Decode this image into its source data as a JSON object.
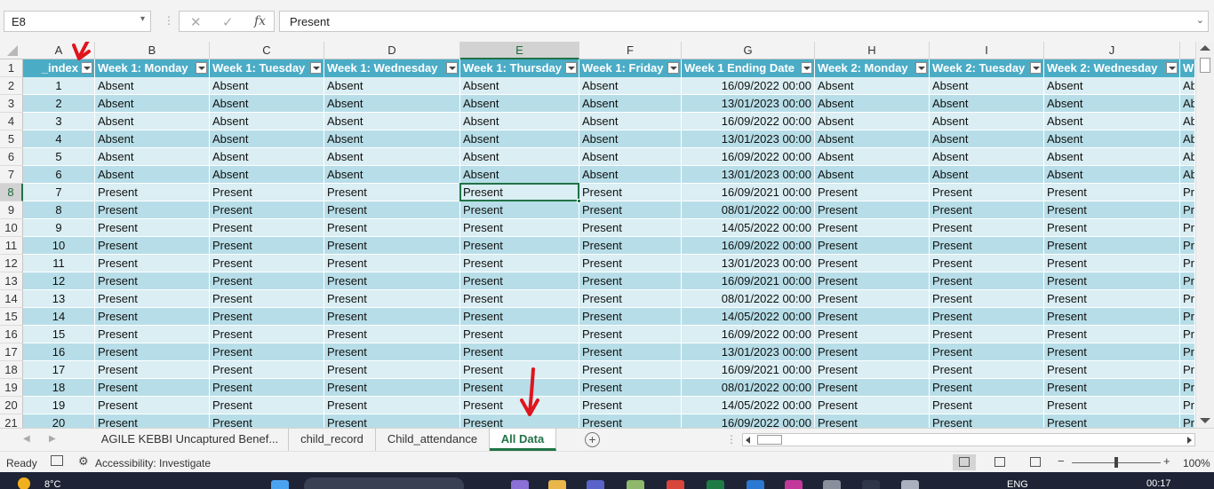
{
  "formula_bar": {
    "name_box": "E8",
    "dots": "⋮",
    "cancel_icon": "✕",
    "enter_icon": "✓",
    "fx_label": "fx",
    "value": "Present"
  },
  "columns": [
    "A",
    "B",
    "C",
    "D",
    "E",
    "F",
    "G",
    "H",
    "I",
    "J"
  ],
  "selected_column": "E",
  "table_headers": [
    "_index",
    "Week 1: Monday",
    "Week 1: Tuesday",
    "Week 1: Wednesday",
    "Week 1: Thursday",
    "Week 1: Friday",
    "Week 1 Ending Date",
    "Week 2: Monday",
    "Week 2: Tuesday",
    "Week 2: Wednesday",
    "W"
  ],
  "row_numbers": [
    1,
    2,
    3,
    4,
    5,
    6,
    7,
    8,
    9,
    10,
    11,
    12,
    13,
    14,
    15,
    16,
    17,
    18,
    19,
    20,
    21
  ],
  "selected_row": 8,
  "data_rows": [
    {
      "index": "1",
      "status": "Absent",
      "date": "16/09/2022 00:00",
      "overflow": "Ab"
    },
    {
      "index": "2",
      "status": "Absent",
      "date": "13/01/2023 00:00",
      "overflow": "Ab"
    },
    {
      "index": "3",
      "status": "Absent",
      "date": "16/09/2022 00:00",
      "overflow": "Ab"
    },
    {
      "index": "4",
      "status": "Absent",
      "date": "13/01/2023 00:00",
      "overflow": "Ab"
    },
    {
      "index": "5",
      "status": "Absent",
      "date": "16/09/2022 00:00",
      "overflow": "Ab"
    },
    {
      "index": "6",
      "status": "Absent",
      "date": "13/01/2023 00:00",
      "overflow": "Ab"
    },
    {
      "index": "7",
      "status": "Present",
      "date": "16/09/2021 00:00",
      "overflow": "Pr"
    },
    {
      "index": "8",
      "status": "Present",
      "date": "08/01/2022 00:00",
      "overflow": "Pr"
    },
    {
      "index": "9",
      "status": "Present",
      "date": "14/05/2022 00:00",
      "overflow": "Pr"
    },
    {
      "index": "10",
      "status": "Present",
      "date": "16/09/2022 00:00",
      "overflow": "Pr"
    },
    {
      "index": "11",
      "status": "Present",
      "date": "13/01/2023 00:00",
      "overflow": "Pr"
    },
    {
      "index": "12",
      "status": "Present",
      "date": "16/09/2021 00:00",
      "overflow": "Pr"
    },
    {
      "index": "13",
      "status": "Present",
      "date": "08/01/2022 00:00",
      "overflow": "Pr"
    },
    {
      "index": "14",
      "status": "Present",
      "date": "14/05/2022 00:00",
      "overflow": "Pr"
    },
    {
      "index": "15",
      "status": "Present",
      "date": "16/09/2022 00:00",
      "overflow": "Pr"
    },
    {
      "index": "16",
      "status": "Present",
      "date": "13/01/2023 00:00",
      "overflow": "Pr"
    },
    {
      "index": "17",
      "status": "Present",
      "date": "16/09/2021 00:00",
      "overflow": "Pr"
    },
    {
      "index": "18",
      "status": "Present",
      "date": "08/01/2022 00:00",
      "overflow": "Pr"
    },
    {
      "index": "19",
      "status": "Present",
      "date": "14/05/2022 00:00",
      "overflow": "Pr"
    },
    {
      "index": "20",
      "status": "Present",
      "date": "16/09/2022 00:00",
      "overflow": "Pr"
    }
  ],
  "sheet_tabs": [
    {
      "label": "AGILE KEBBI Uncaptured Benef...",
      "active": false
    },
    {
      "label": "child_record",
      "active": false
    },
    {
      "label": "Child_attendance",
      "active": false
    },
    {
      "label": "All Data",
      "active": true
    }
  ],
  "tabs_bar": {
    "add_label": "+",
    "prev_icon": "◀",
    "next_icon": "▶",
    "dots": "⋮"
  },
  "status_bar": {
    "ready": "Ready",
    "accessibility": "Accessibility: Investigate",
    "zoom_minus": "−",
    "zoom_plus": "+",
    "zoom": "100%",
    "zoom_fraction": 0.5
  },
  "taskbar": {
    "temperature": "8°C",
    "language": "ENG",
    "clock": "00:17"
  },
  "colors": {
    "header_fill": "#4bacc6",
    "band_dark": "#b7dee8",
    "band_light": "#daeef3",
    "excel_green": "#217346",
    "annotation_red": "#e0141e"
  },
  "icons": [
    "name-box-dropdown-icon",
    "cancel-icon",
    "enter-icon",
    "function-icon",
    "filter-dropdown-icon",
    "add-sheet-icon",
    "macro-icon",
    "accessibility-icon",
    "normal-view-icon",
    "page-layout-icon",
    "page-break-icon",
    "red-annotation-arrow"
  ]
}
